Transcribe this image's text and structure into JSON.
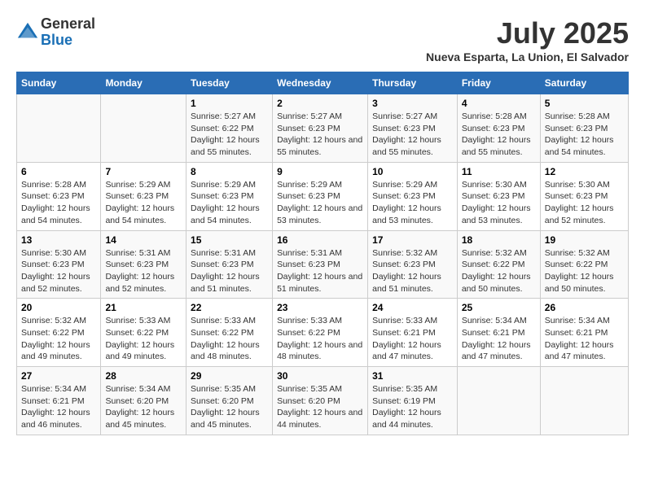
{
  "logo": {
    "general": "General",
    "blue": "Blue"
  },
  "title": {
    "month_year": "July 2025",
    "location": "Nueva Esparta, La Union, El Salvador"
  },
  "days_of_week": [
    "Sunday",
    "Monday",
    "Tuesday",
    "Wednesday",
    "Thursday",
    "Friday",
    "Saturday"
  ],
  "weeks": [
    [
      {
        "num": "",
        "sunrise": "",
        "sunset": "",
        "daylight": ""
      },
      {
        "num": "",
        "sunrise": "",
        "sunset": "",
        "daylight": ""
      },
      {
        "num": "1",
        "sunrise": "Sunrise: 5:27 AM",
        "sunset": "Sunset: 6:22 PM",
        "daylight": "Daylight: 12 hours and 55 minutes."
      },
      {
        "num": "2",
        "sunrise": "Sunrise: 5:27 AM",
        "sunset": "Sunset: 6:23 PM",
        "daylight": "Daylight: 12 hours and 55 minutes."
      },
      {
        "num": "3",
        "sunrise": "Sunrise: 5:27 AM",
        "sunset": "Sunset: 6:23 PM",
        "daylight": "Daylight: 12 hours and 55 minutes."
      },
      {
        "num": "4",
        "sunrise": "Sunrise: 5:28 AM",
        "sunset": "Sunset: 6:23 PM",
        "daylight": "Daylight: 12 hours and 55 minutes."
      },
      {
        "num": "5",
        "sunrise": "Sunrise: 5:28 AM",
        "sunset": "Sunset: 6:23 PM",
        "daylight": "Daylight: 12 hours and 54 minutes."
      }
    ],
    [
      {
        "num": "6",
        "sunrise": "Sunrise: 5:28 AM",
        "sunset": "Sunset: 6:23 PM",
        "daylight": "Daylight: 12 hours and 54 minutes."
      },
      {
        "num": "7",
        "sunrise": "Sunrise: 5:29 AM",
        "sunset": "Sunset: 6:23 PM",
        "daylight": "Daylight: 12 hours and 54 minutes."
      },
      {
        "num": "8",
        "sunrise": "Sunrise: 5:29 AM",
        "sunset": "Sunset: 6:23 PM",
        "daylight": "Daylight: 12 hours and 54 minutes."
      },
      {
        "num": "9",
        "sunrise": "Sunrise: 5:29 AM",
        "sunset": "Sunset: 6:23 PM",
        "daylight": "Daylight: 12 hours and 53 minutes."
      },
      {
        "num": "10",
        "sunrise": "Sunrise: 5:29 AM",
        "sunset": "Sunset: 6:23 PM",
        "daylight": "Daylight: 12 hours and 53 minutes."
      },
      {
        "num": "11",
        "sunrise": "Sunrise: 5:30 AM",
        "sunset": "Sunset: 6:23 PM",
        "daylight": "Daylight: 12 hours and 53 minutes."
      },
      {
        "num": "12",
        "sunrise": "Sunrise: 5:30 AM",
        "sunset": "Sunset: 6:23 PM",
        "daylight": "Daylight: 12 hours and 52 minutes."
      }
    ],
    [
      {
        "num": "13",
        "sunrise": "Sunrise: 5:30 AM",
        "sunset": "Sunset: 6:23 PM",
        "daylight": "Daylight: 12 hours and 52 minutes."
      },
      {
        "num": "14",
        "sunrise": "Sunrise: 5:31 AM",
        "sunset": "Sunset: 6:23 PM",
        "daylight": "Daylight: 12 hours and 52 minutes."
      },
      {
        "num": "15",
        "sunrise": "Sunrise: 5:31 AM",
        "sunset": "Sunset: 6:23 PM",
        "daylight": "Daylight: 12 hours and 51 minutes."
      },
      {
        "num": "16",
        "sunrise": "Sunrise: 5:31 AM",
        "sunset": "Sunset: 6:23 PM",
        "daylight": "Daylight: 12 hours and 51 minutes."
      },
      {
        "num": "17",
        "sunrise": "Sunrise: 5:32 AM",
        "sunset": "Sunset: 6:23 PM",
        "daylight": "Daylight: 12 hours and 51 minutes."
      },
      {
        "num": "18",
        "sunrise": "Sunrise: 5:32 AM",
        "sunset": "Sunset: 6:22 PM",
        "daylight": "Daylight: 12 hours and 50 minutes."
      },
      {
        "num": "19",
        "sunrise": "Sunrise: 5:32 AM",
        "sunset": "Sunset: 6:22 PM",
        "daylight": "Daylight: 12 hours and 50 minutes."
      }
    ],
    [
      {
        "num": "20",
        "sunrise": "Sunrise: 5:32 AM",
        "sunset": "Sunset: 6:22 PM",
        "daylight": "Daylight: 12 hours and 49 minutes."
      },
      {
        "num": "21",
        "sunrise": "Sunrise: 5:33 AM",
        "sunset": "Sunset: 6:22 PM",
        "daylight": "Daylight: 12 hours and 49 minutes."
      },
      {
        "num": "22",
        "sunrise": "Sunrise: 5:33 AM",
        "sunset": "Sunset: 6:22 PM",
        "daylight": "Daylight: 12 hours and 48 minutes."
      },
      {
        "num": "23",
        "sunrise": "Sunrise: 5:33 AM",
        "sunset": "Sunset: 6:22 PM",
        "daylight": "Daylight: 12 hours and 48 minutes."
      },
      {
        "num": "24",
        "sunrise": "Sunrise: 5:33 AM",
        "sunset": "Sunset: 6:21 PM",
        "daylight": "Daylight: 12 hours and 47 minutes."
      },
      {
        "num": "25",
        "sunrise": "Sunrise: 5:34 AM",
        "sunset": "Sunset: 6:21 PM",
        "daylight": "Daylight: 12 hours and 47 minutes."
      },
      {
        "num": "26",
        "sunrise": "Sunrise: 5:34 AM",
        "sunset": "Sunset: 6:21 PM",
        "daylight": "Daylight: 12 hours and 47 minutes."
      }
    ],
    [
      {
        "num": "27",
        "sunrise": "Sunrise: 5:34 AM",
        "sunset": "Sunset: 6:21 PM",
        "daylight": "Daylight: 12 hours and 46 minutes."
      },
      {
        "num": "28",
        "sunrise": "Sunrise: 5:34 AM",
        "sunset": "Sunset: 6:20 PM",
        "daylight": "Daylight: 12 hours and 45 minutes."
      },
      {
        "num": "29",
        "sunrise": "Sunrise: 5:35 AM",
        "sunset": "Sunset: 6:20 PM",
        "daylight": "Daylight: 12 hours and 45 minutes."
      },
      {
        "num": "30",
        "sunrise": "Sunrise: 5:35 AM",
        "sunset": "Sunset: 6:20 PM",
        "daylight": "Daylight: 12 hours and 44 minutes."
      },
      {
        "num": "31",
        "sunrise": "Sunrise: 5:35 AM",
        "sunset": "Sunset: 6:19 PM",
        "daylight": "Daylight: 12 hours and 44 minutes."
      },
      {
        "num": "",
        "sunrise": "",
        "sunset": "",
        "daylight": ""
      },
      {
        "num": "",
        "sunrise": "",
        "sunset": "",
        "daylight": ""
      }
    ]
  ]
}
